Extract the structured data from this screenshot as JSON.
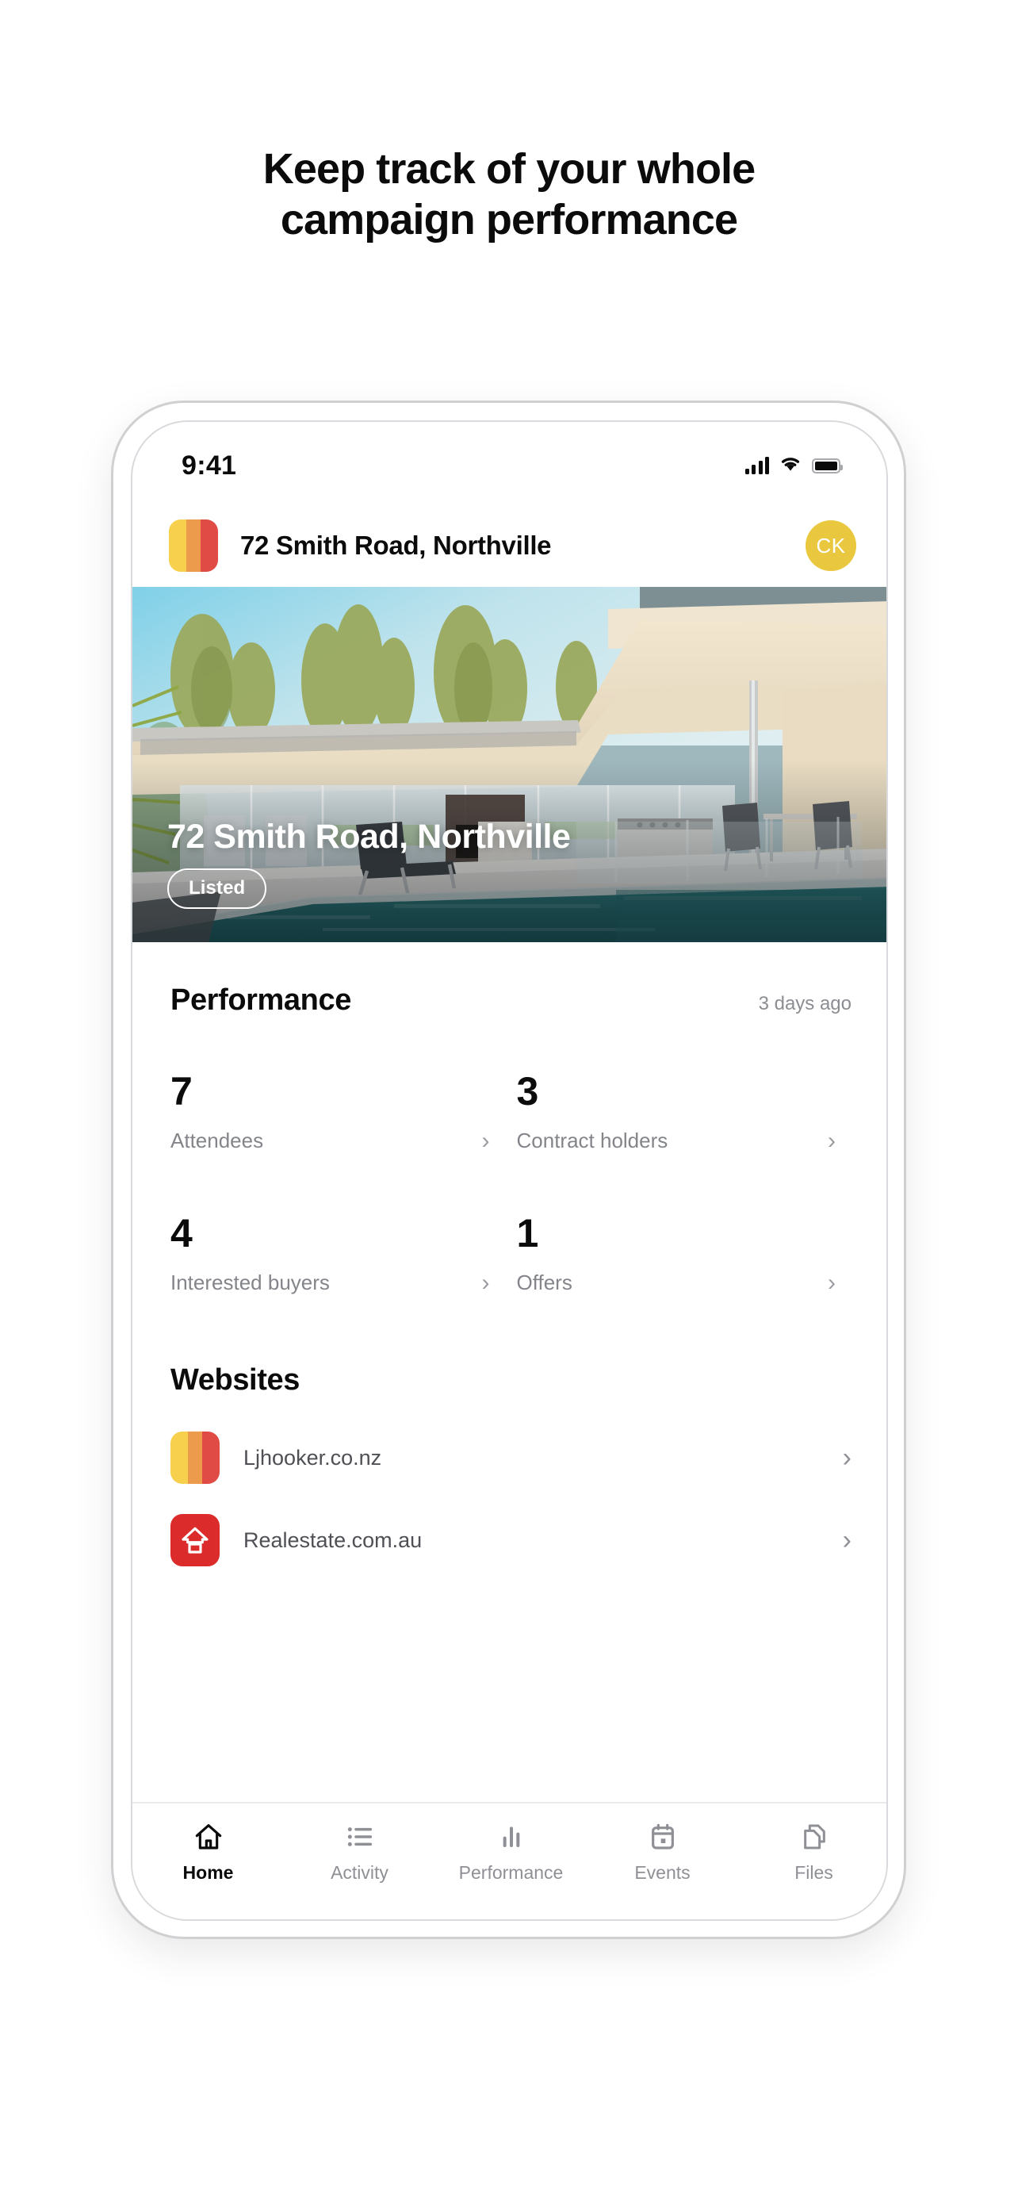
{
  "headline": {
    "line1": "Keep track of your whole",
    "line2": "campaign performance"
  },
  "statusbar": {
    "time": "9:41",
    "signal_icon": "cellular-signal-icon",
    "wifi_icon": "wifi-icon",
    "battery_icon": "battery-full-icon"
  },
  "app_header": {
    "logo_icon": "ljhooker-logo-icon",
    "title": "72 Smith Road, Northville",
    "avatar_initials": "CK"
  },
  "hero": {
    "title": "72 Smith Road, Northville",
    "badge": "Listed"
  },
  "performance": {
    "title": "Performance",
    "updated": "3 days ago",
    "stats": [
      {
        "value": "7",
        "label": "Attendees",
        "chevron": "›"
      },
      {
        "value": "3",
        "label": "Contract holders",
        "chevron": "›"
      },
      {
        "value": "4",
        "label": "Interested buyers",
        "chevron": "›"
      },
      {
        "value": "1",
        "label": "Offers",
        "chevron": "›"
      }
    ]
  },
  "websites": {
    "title": "Websites",
    "items": [
      {
        "label": "Ljhooker.co.nz",
        "icon": "ljhooker-logo-icon",
        "chevron": "›"
      },
      {
        "label": "Realestate.com.au",
        "icon": "realestate-house-icon",
        "chevron": "›"
      }
    ]
  },
  "tabbar": {
    "tabs": [
      {
        "label": "Home",
        "icon": "home-icon",
        "active": true
      },
      {
        "label": "Activity",
        "icon": "list-icon",
        "active": false
      },
      {
        "label": "Performance",
        "icon": "bar-chart-icon",
        "active": false
      },
      {
        "label": "Events",
        "icon": "calendar-icon",
        "active": false
      },
      {
        "label": "Files",
        "icon": "files-icon",
        "active": false
      }
    ]
  },
  "colors": {
    "brand_yellow": "#f7d14e",
    "brand_orange": "#ec9a4c",
    "brand_red": "#e14b46",
    "avatar_gold": "#e9c840",
    "realestate_red": "#db2b2b",
    "text_primary": "#0b0b0c",
    "text_muted": "#83858a"
  }
}
